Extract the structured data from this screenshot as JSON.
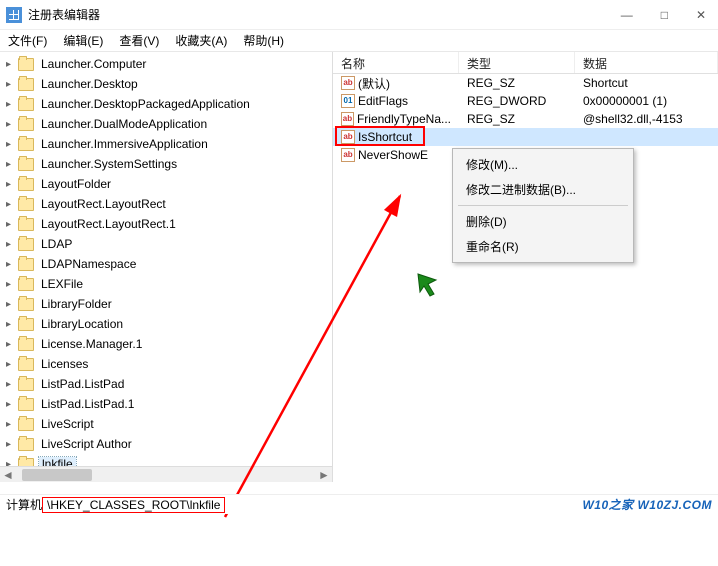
{
  "window": {
    "title": "注册表编辑器"
  },
  "menubar": {
    "file": "文件(F)",
    "edit": "编辑(E)",
    "view": "查看(V)",
    "fav": "收藏夹(A)",
    "help": "帮助(H)"
  },
  "tree": {
    "items": [
      {
        "label": "Launcher.Computer"
      },
      {
        "label": "Launcher.Desktop"
      },
      {
        "label": "Launcher.DesktopPackagedApplication"
      },
      {
        "label": "Launcher.DualModeApplication"
      },
      {
        "label": "Launcher.ImmersiveApplication"
      },
      {
        "label": "Launcher.SystemSettings"
      },
      {
        "label": "LayoutFolder"
      },
      {
        "label": "LayoutRect.LayoutRect"
      },
      {
        "label": "LayoutRect.LayoutRect.1"
      },
      {
        "label": "LDAP"
      },
      {
        "label": "LDAPNamespace"
      },
      {
        "label": "LEXFile"
      },
      {
        "label": "LibraryFolder"
      },
      {
        "label": "LibraryLocation"
      },
      {
        "label": "License.Manager.1"
      },
      {
        "label": "Licenses"
      },
      {
        "label": "ListPad.ListPad"
      },
      {
        "label": "ListPad.ListPad.1"
      },
      {
        "label": "LiveScript"
      },
      {
        "label": "LiveScript Author"
      },
      {
        "label": "lnkfile",
        "selected": true
      }
    ]
  },
  "list": {
    "headers": {
      "name": "名称",
      "type": "类型",
      "data": "数据"
    },
    "rows": [
      {
        "icon": "ab",
        "name": "(默认)",
        "type": "REG_SZ",
        "data": "Shortcut"
      },
      {
        "icon": "bin",
        "name": "EditFlags",
        "type": "REG_DWORD",
        "data": "0x00000001 (1)"
      },
      {
        "icon": "ab",
        "name": "FriendlyTypeNa...",
        "type": "REG_SZ",
        "data": "@shell32.dll,-4153"
      },
      {
        "icon": "ab",
        "name": "IsShortcut",
        "type": "",
        "data": "",
        "selected": true
      },
      {
        "icon": "ab",
        "name": "NeverShowE",
        "type": "",
        "data": ""
      }
    ]
  },
  "context_menu": {
    "modify": "修改(M)...",
    "modify_binary": "修改二进制数据(B)...",
    "delete": "删除(D)",
    "rename": "重命名(R)"
  },
  "statusbar": {
    "prefix": "计算机",
    "path": "\\HKEY_CLASSES_ROOT\\lnkfile",
    "watermark": "W10之家 W10ZJ.COM"
  }
}
